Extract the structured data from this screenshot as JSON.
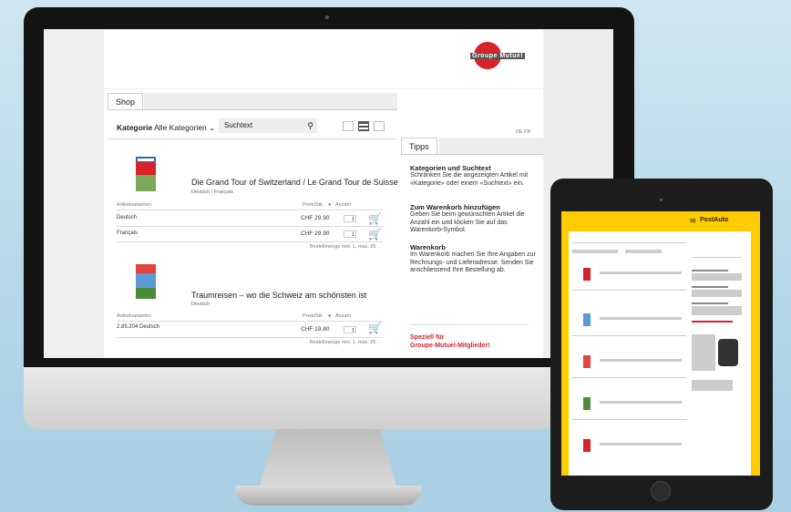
{
  "shop": {
    "tab_label": "Shop",
    "kategorie_label": "Kategorie",
    "kategorie_value": "Alle Kategorien",
    "search_placeholder": "Suchtext",
    "lang_switch": "DE FR"
  },
  "products": [
    {
      "title": "Die Grand Tour of Switzerland / Le Grand Tour de Suisse",
      "subtitle": "Deutsch / Français",
      "col_article": "Artikelvarianten",
      "col_price": "Preis/Stk",
      "col_qty": "Anzahl",
      "rows": [
        {
          "variant": "Deutsch",
          "price": "CHF 29.90",
          "qty": "1"
        },
        {
          "variant": "Français",
          "price": "CHF 29.90",
          "qty": "1"
        }
      ],
      "order_note": "Bestellmenge min. 1, max. 25"
    },
    {
      "title": "Traumreisen – wo die Schweiz am schönsten ist",
      "subtitle": "Deutsch",
      "col_article": "Artikelvarianten",
      "col_price": "Preis/Stk",
      "col_qty": "Anzahl",
      "rows": [
        {
          "variant": "2.85.204 Deutsch",
          "price": "CHF 19.80",
          "qty": "1"
        }
      ],
      "order_note": "Bestellmenge min. 1, max. 25"
    }
  ],
  "tipps": {
    "tab_label": "Tipps",
    "sections": [
      {
        "title": "Kategorien und Suchtext",
        "text": "Schränken Sie die angezeigten Artikel mit «Kategorie» oder einem «Suchtext» ein."
      },
      {
        "title": "Zum Warenkorb hinzufügen",
        "text": "Geben Sie beim gewünschten Artikel die Anzahl ein und klicken Sie auf das Warenkorb-Symbol."
      },
      {
        "title": "Warenkorb",
        "text": "Im Warenkorb machen Sie Ihre Angaben zur Rechnungs- und Lieferadresse. Senden Sie anschliessend Ihre Bestellung ab."
      }
    ],
    "promo_line1": "Speziell für",
    "promo_line2": "Groupe-Mutuel-Mitglieder!"
  },
  "logo": {
    "text": "Groupe Mutuel"
  },
  "ipad": {
    "brand": "PostAuto"
  },
  "colors": {
    "brand_red": "#d8232a",
    "postauto_yellow": "#ffcc00"
  }
}
